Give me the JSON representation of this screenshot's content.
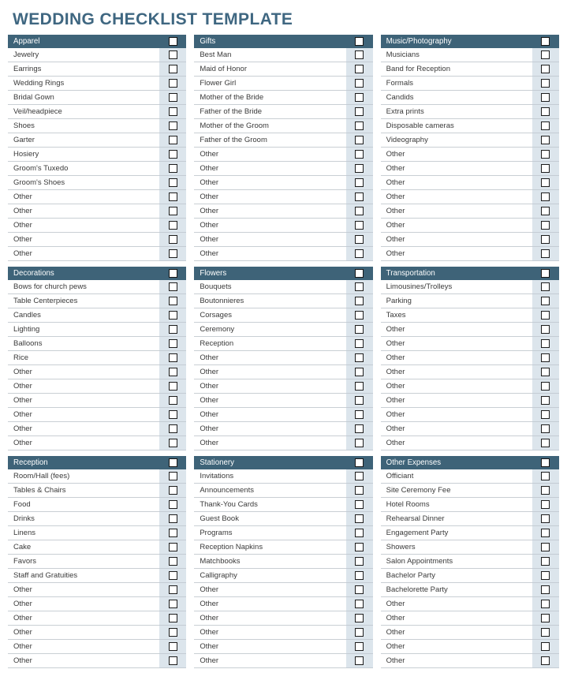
{
  "document": {
    "title": "WEDDING CHECKLIST TEMPLATE"
  },
  "theme": {
    "header_bar": "#3e6378",
    "title_color": "#3f6781",
    "checkbox_column": "#dce5ec",
    "row_divider": "#c9cfd4",
    "page_background": "#ffffff"
  },
  "icons": {
    "checkbox": "checkbox-icon"
  },
  "tables": [
    {
      "title": "Apparel",
      "items": [
        "Jewelry",
        "Earrings",
        "Wedding Rings",
        "Bridal Gown",
        "Veil/headpiece",
        "Shoes",
        "Garter",
        "Hosiery",
        "Groom's Tuxedo",
        "Groom's Shoes",
        "Other",
        "Other",
        "Other",
        "Other",
        "Other"
      ]
    },
    {
      "title": "Gifts",
      "items": [
        "Best Man",
        "Maid of Honor",
        "Flower Girl",
        "Mother of the Bride",
        "Father of the Bride",
        "Mother of the Groom",
        "Father of the Groom",
        "Other",
        "Other",
        "Other",
        "Other",
        "Other",
        "Other",
        "Other",
        "Other"
      ]
    },
    {
      "title": "Music/Photography",
      "items": [
        "Musicians",
        "Band for Reception",
        "Formals",
        "Candids",
        "Extra prints",
        "Disposable cameras",
        "Videography",
        "Other",
        "Other",
        "Other",
        "Other",
        "Other",
        "Other",
        "Other",
        "Other"
      ]
    },
    {
      "title": "Decorations",
      "items": [
        "Bows for church pews",
        "Table Centerpieces",
        "Candles",
        "Lighting",
        "Balloons",
        "Rice",
        "Other",
        "Other",
        "Other",
        "Other",
        "Other",
        "Other"
      ]
    },
    {
      "title": "Flowers",
      "items": [
        "Bouquets",
        "Boutonnieres",
        "Corsages",
        "Ceremony",
        "Reception",
        "Other",
        "Other",
        "Other",
        "Other",
        "Other",
        "Other",
        "Other"
      ]
    },
    {
      "title": "Transportation",
      "items": [
        "Limousines/Trolleys",
        "Parking",
        "Taxes",
        "Other",
        "Other",
        "Other",
        "Other",
        "Other",
        "Other",
        "Other",
        "Other",
        "Other"
      ]
    },
    {
      "title": "Reception",
      "items": [
        "Room/Hall (fees)",
        "Tables & Chairs",
        "Food",
        "Drinks",
        "Linens",
        "Cake",
        "Favors",
        "Staff and Gratuities",
        "Other",
        "Other",
        "Other",
        "Other",
        "Other",
        "Other"
      ]
    },
    {
      "title": "Stationery",
      "items": [
        "Invitations",
        "Announcements",
        "Thank-You Cards",
        "Guest Book",
        "Programs",
        "Reception Napkins",
        "Matchbooks",
        "Calligraphy",
        "Other",
        "Other",
        "Other",
        "Other",
        "Other",
        "Other"
      ]
    },
    {
      "title": "Other Expenses",
      "items": [
        "Officiant",
        "Site Ceremony Fee",
        "Hotel Rooms",
        "Rehearsal Dinner",
        "Engagement Party",
        "Showers",
        "Salon Appointments",
        "Bachelor Party",
        "Bachelorette Party",
        "Other",
        "Other",
        "Other",
        "Other",
        "Other"
      ]
    }
  ],
  "layout": {
    "rows": [
      [
        0,
        1,
        2
      ],
      [
        3,
        4,
        5
      ],
      [
        6,
        7,
        8
      ]
    ]
  }
}
